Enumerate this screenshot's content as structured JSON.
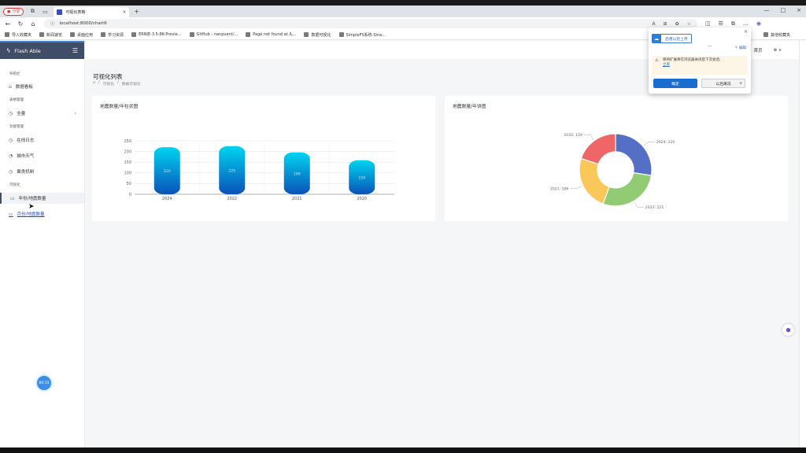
{
  "browser": {
    "profile_label": "分享",
    "tab_title": "可视化表格",
    "url": "localhost:8000/chart6",
    "bookmarks": [
      "导入收藏夹",
      "新闻速览",
      "桌面应用",
      "学习资源",
      "ERNIE-3.5-8K-Previe...",
      "GitHub - nanpuent/...",
      "Page not found at /L...",
      "数据可视化",
      "SimpleFS系统-Sina..."
    ],
    "bookmarks_right": "其他收藏夹"
  },
  "sidebar": {
    "brand": "Flash Able",
    "sections": [
      {
        "caption": "导航栏",
        "items": [
          {
            "label": "数据看板"
          }
        ]
      },
      {
        "caption": "表格管理",
        "items": [
          {
            "label": "全量",
            "has_arrow": true
          }
        ]
      },
      {
        "caption": "功能管理",
        "items": [
          {
            "label": "在线日志"
          },
          {
            "label": "城市天气"
          },
          {
            "label": "聚类机制"
          }
        ]
      },
      {
        "caption": "可视化",
        "items": [
          {
            "label": "年份/地震数量",
            "active": true
          },
          {
            "label": "月份/地震数量",
            "hover": true
          }
        ]
      }
    ],
    "fab_label": "00:15"
  },
  "header": {
    "item1": "首页",
    "item2": "⊕ ∨"
  },
  "page": {
    "title": "可视化列表",
    "breadcrumb": [
      "⌂",
      "/",
      "可视化",
      "/",
      "数据可视化"
    ]
  },
  "cards": {
    "bar_title": "地震数量/年柱状图",
    "donut_title": "地震数量/年饼图"
  },
  "popup": {
    "button": "启用以后上传",
    "edit": "编辑",
    "warning": "保持扩展将在浏览器关闭后下次会话,",
    "warning_link": "立即",
    "ok": "确定",
    "later": "以后再说"
  },
  "chart_data": [
    {
      "type": "bar",
      "categories": [
        "2024",
        "2022",
        "2021",
        "2020"
      ],
      "values": [
        220,
        225,
        196,
        159
      ],
      "ylim": [
        0,
        250
      ],
      "yticks": [
        0,
        50,
        100,
        150,
        200,
        250
      ],
      "colors": [
        "#00d4f0",
        "#0a52b8"
      ]
    },
    {
      "type": "pie",
      "labels": [
        "2024",
        "2022",
        "2021",
        "2020"
      ],
      "values": [
        220,
        225,
        196,
        159
      ],
      "colors": [
        "#5470c6",
        "#91cc75",
        "#fac858",
        "#ee6666"
      ],
      "slice_labels": [
        "2024: 220",
        "2022: 225",
        "2021: 196",
        "2020: 159"
      ]
    }
  ]
}
